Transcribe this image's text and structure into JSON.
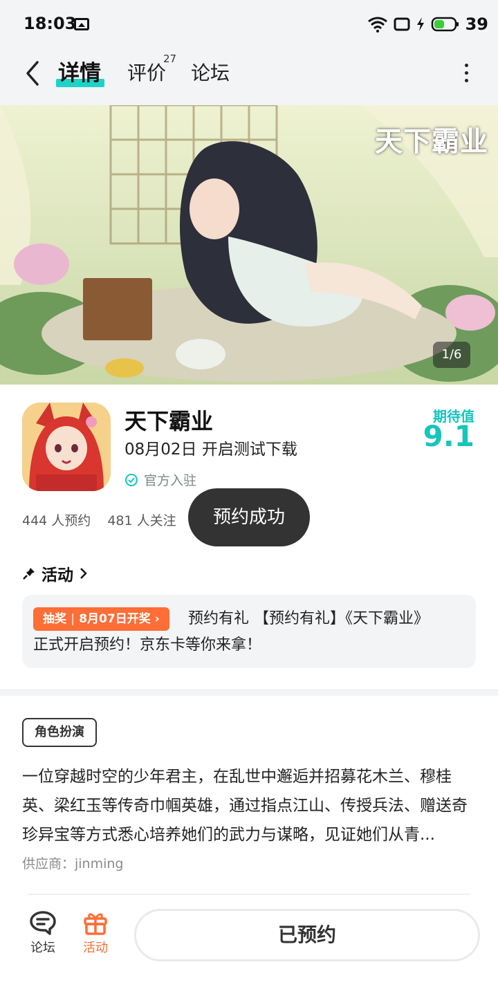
{
  "status_bar": {
    "time": "18:03",
    "battery": "39"
  },
  "nav": {
    "tabs": [
      {
        "label": "详情"
      },
      {
        "label": "评价",
        "badge": "27"
      },
      {
        "label": "论坛"
      }
    ]
  },
  "banner": {
    "logo_text": "天下霸业",
    "counter": "1/6"
  },
  "game": {
    "title": "天下霸业",
    "subtitle": "08月02日 开启测试下载",
    "official": "官方入驻",
    "expect_label": "期待值",
    "expect_score": "9.1",
    "reservations": "444 人预约",
    "followers": "481 人关注"
  },
  "toast": "预约成功",
  "activity": {
    "header": "活动",
    "badge_type": "抽奖",
    "badge_date": "8月07日开奖",
    "text_line1": "预约有礼 【预约有礼】《天下霸业》",
    "text_line2": "正式开启预约！京东卡等你来拿！"
  },
  "details": {
    "genre_tag": "角色扮演",
    "description": "一位穿越时空的少年君主，在乱世中邂逅并招募花木兰、穆桂英、梁红玉等传奇巾帼英雄，通过指点江山、传授兵法、赠送奇珍异宝等方式悉心培养她们的武力与谋略，见证她们从青...",
    "supplier": "供应商：jinming"
  },
  "bottom_bar": {
    "forum_label": "论坛",
    "activity_label": "活动",
    "reserved_label": "已预约"
  },
  "colors": {
    "accent_teal": "#16c5bb",
    "accent_orange": "#ff6e36",
    "toast_bg": "#333333"
  }
}
